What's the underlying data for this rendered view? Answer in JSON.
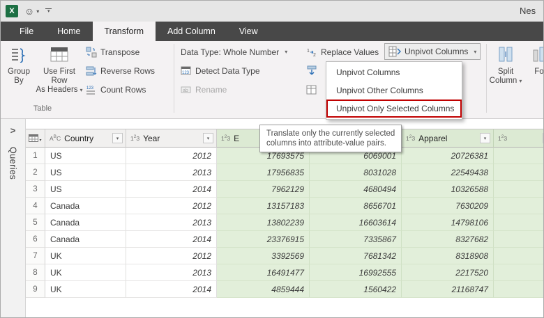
{
  "titlebar": {
    "title": "Nes"
  },
  "tabs": [
    {
      "label": "File",
      "active": false
    },
    {
      "label": "Home",
      "active": false
    },
    {
      "label": "Transform",
      "active": true
    },
    {
      "label": "Add Column",
      "active": false
    },
    {
      "label": "View",
      "active": false
    }
  ],
  "ribbon": {
    "group_by_line1": "Group",
    "group_by_line2": "By",
    "use_first_row_line1": "Use First Row",
    "use_first_row_line2": "As Headers",
    "table_group_label": "Table",
    "transpose_label": "Transpose",
    "reverse_rows_label": "Reverse Rows",
    "count_rows_label": "Count Rows",
    "data_type_label": "Data Type: Whole Number",
    "detect_data_type_label": "Detect Data Type",
    "rename_label": "Rename",
    "replace_values_label": "Replace Values",
    "unpivot_columns_label": "Unpivot Columns",
    "split_line1": "Split",
    "split_line2": "Column",
    "format_partial_label": "Fo"
  },
  "menu": {
    "items": [
      {
        "label": "Unpivot Columns",
        "highlighted": false
      },
      {
        "label": "Unpivot Other Columns",
        "highlighted": false
      },
      {
        "label": "Unpivot Only Selected Columns",
        "highlighted": true
      }
    ],
    "highlight_color": "#c00000"
  },
  "tooltip": {
    "line1": "Translate only the currently selected",
    "line2": "columns into attribute-value pairs."
  },
  "queries_pane": {
    "label": "Queries"
  },
  "grid": {
    "columns": [
      {
        "type": "text",
        "type_glyph": "ABC",
        "label": "Country",
        "selected": false
      },
      {
        "type": "number",
        "type_glyph": "123",
        "label": "Year",
        "selected": false
      },
      {
        "type": "number",
        "type_glyph": "123",
        "label": "E",
        "selected": true
      },
      {
        "type": "number",
        "type_glyph": "123",
        "label": "",
        "selected": true
      },
      {
        "type": "number",
        "type_glyph": "123",
        "label": "Apparel",
        "selected": true
      },
      {
        "type": "number",
        "type_glyph": "123",
        "label": "",
        "selected": true
      }
    ],
    "rows": [
      [
        "US",
        "2012",
        "17693575",
        "6069001",
        "20726381",
        ""
      ],
      [
        "US",
        "2013",
        "17956835",
        "8031028",
        "22549438",
        ""
      ],
      [
        "US",
        "2014",
        "7962129",
        "4680494",
        "10326588",
        ""
      ],
      [
        "Canada",
        "2012",
        "13157183",
        "8656701",
        "7630209",
        ""
      ],
      [
        "Canada",
        "2013",
        "13802239",
        "16603614",
        "14798106",
        ""
      ],
      [
        "Canada",
        "2014",
        "23376915",
        "7335867",
        "8327682",
        ""
      ],
      [
        "UK",
        "2012",
        "3392569",
        "7681342",
        "8318908",
        ""
      ],
      [
        "UK",
        "2013",
        "16491477",
        "16992555",
        "2217520",
        ""
      ],
      [
        "UK",
        "2014",
        "4859444",
        "1560422",
        "21168747",
        ""
      ]
    ]
  }
}
